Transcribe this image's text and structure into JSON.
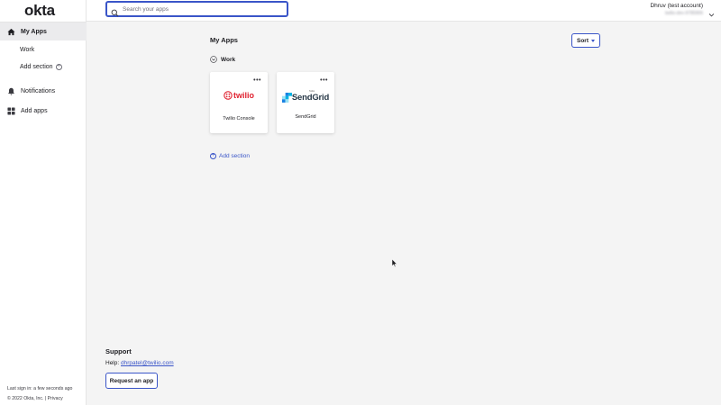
{
  "brand": {
    "logo_text": "okta",
    "accent_color": "#3a55c8"
  },
  "sidebar": {
    "items": [
      {
        "label": "My Apps",
        "icon": "home-icon",
        "active": true
      },
      {
        "label": "Work",
        "icon": ""
      },
      {
        "label": "Add section",
        "icon": "circle-plus-icon"
      },
      {
        "label": "Notifications",
        "icon": "bell-icon"
      },
      {
        "label": "Add apps",
        "icon": "grid-icon"
      }
    ],
    "last_sign_in": "Last sign in: a few seconds ago",
    "copyright": "© 2022 Okta, Inc. | Privacy"
  },
  "header": {
    "search_placeholder": "Search your apps",
    "account_name": "Dhruv (test account)",
    "account_org": "twilio-dev-9785906"
  },
  "main": {
    "title": "My Apps",
    "sort_label": "Sort",
    "section_name": "Work",
    "apps": [
      {
        "name": "Twilio Console",
        "logo_text": "twilio"
      },
      {
        "name": "SendGrid",
        "logo_text": "SendGrid",
        "logo_subtext": "Twilio"
      }
    ],
    "add_section_label": "Add section"
  },
  "support": {
    "title": "Support",
    "help_prefix": "Help:",
    "help_email": "dhrpatel@twilio.com",
    "request_label": "Request an app"
  }
}
